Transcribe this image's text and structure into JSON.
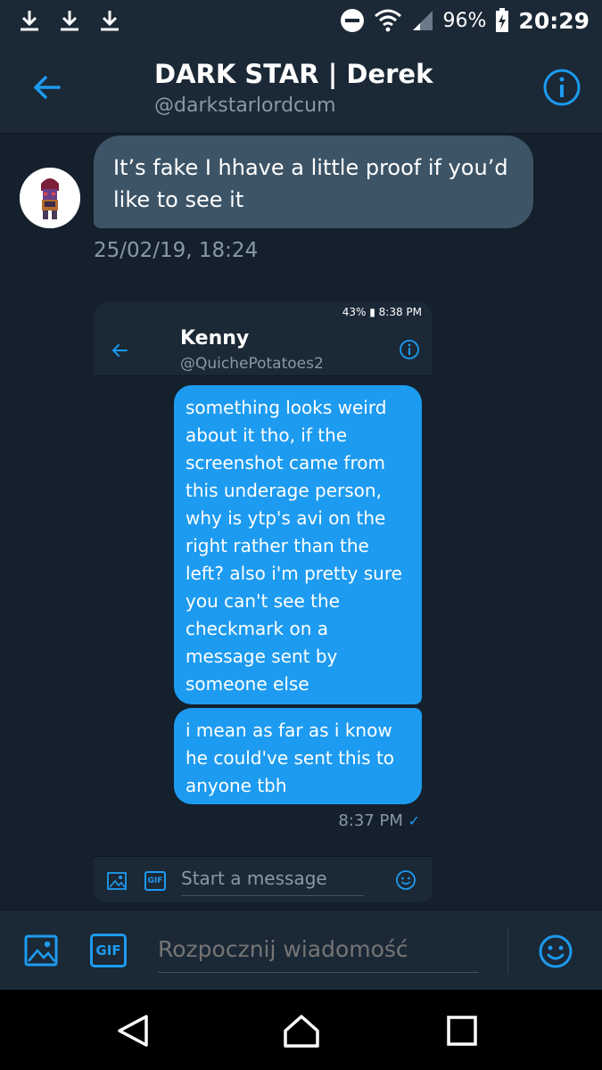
{
  "status_bar": {
    "battery": "96%",
    "time": "20:29",
    "icons": [
      "download-icon",
      "download-icon",
      "download-icon",
      "do-not-disturb-icon",
      "wifi-icon",
      "signal-icon",
      "battery-charging-icon"
    ]
  },
  "header": {
    "title": "DARK STAR | Derek",
    "handle": "@darkstarlordcum"
  },
  "conversation": {
    "incoming_message": "It’s fake I hhave a little proof if you’d like to see it",
    "timestamp": "25/02/19, 18:24"
  },
  "embedded_screenshot": {
    "status_text": "43% ▮ 8:38 PM",
    "title": "Kenny",
    "handle": "@QuichePotatoes2",
    "messages": [
      "something looks weird about it tho, if the screenshot came from this underage person, why is ytp's avi on the right rather than the left? also i'm pretty sure you can't see the checkmark on a message sent by someone else",
      "i mean as far as i know he could've sent this to anyone tbh"
    ],
    "sent_time": "8:37 PM",
    "check": "✓",
    "compose_placeholder": "Start a message",
    "gif_label": "GIF"
  },
  "compose": {
    "placeholder": "Rozpocznij wiadomość",
    "gif_label": "GIF"
  },
  "colors": {
    "accent": "#1d9bf0",
    "background": "#14202c",
    "bar": "#1b2836",
    "incoming_bubble": "#3d5466",
    "secondary_text": "#8899a6"
  }
}
